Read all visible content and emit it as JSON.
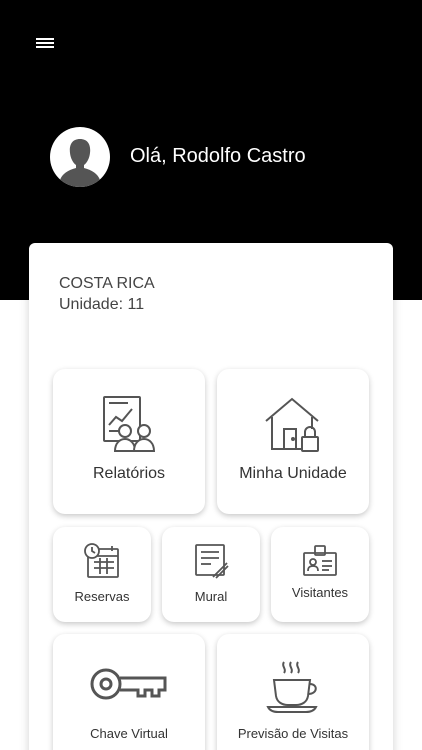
{
  "header": {
    "greeting": "Olá, Rodolfo Castro",
    "menu_icon": "hamburger-menu-icon",
    "avatar_icon": "user-silhouette-icon"
  },
  "condo": {
    "name": "COSTA RICA",
    "unit": "Unidade: 11"
  },
  "tiles": {
    "reports": {
      "label": "Relatórios",
      "icon": "reports-people-icon"
    },
    "my_unit": {
      "label": "Minha Unidade",
      "icon": "house-lock-icon"
    },
    "reservations": {
      "label": "Reservas",
      "icon": "calendar-clock-icon"
    },
    "wall": {
      "label": "Mural",
      "icon": "notepad-pencil-icon"
    },
    "visitors": {
      "label": "Visitantes",
      "icon": "id-badge-icon"
    },
    "virtual_key": {
      "label": "Chave Virtual",
      "icon": "key-icon"
    },
    "visit_forecast": {
      "label": "Previsão de Visitas",
      "icon": "coffee-cup-icon"
    }
  },
  "colors": {
    "header_bg": "#000000",
    "icon_stroke": "#555555"
  }
}
